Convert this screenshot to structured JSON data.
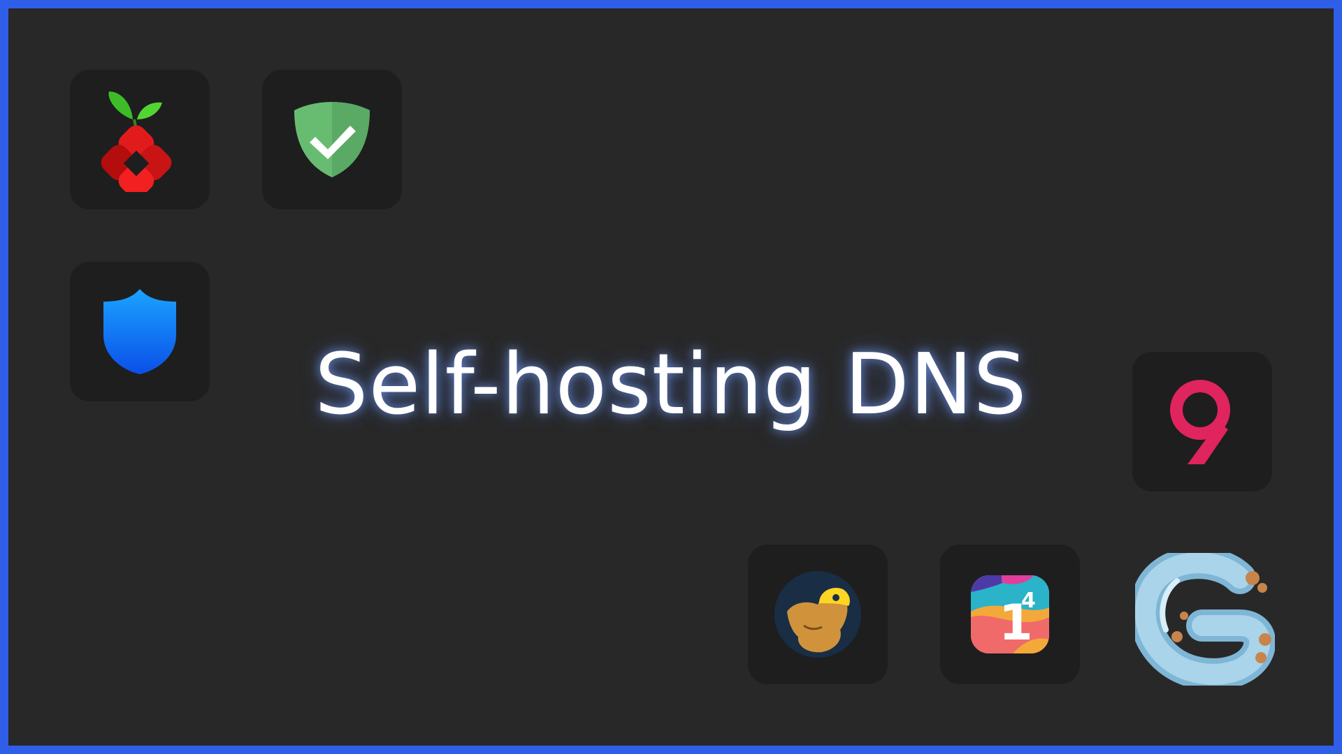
{
  "headline": "Self-hosting DNS",
  "colors": {
    "border": "#2f5fe8",
    "background": "#282828",
    "tile": "#1e1e1f",
    "glow": "#78a0ff"
  },
  "icons": [
    {
      "name": "pihole-icon"
    },
    {
      "name": "adguard-icon"
    },
    {
      "name": "technitium-shield-icon"
    },
    {
      "name": "quad9-icon",
      "glyph": "9"
    },
    {
      "name": "mullvad-mole-icon"
    },
    {
      "name": "one-one-one-one-icon",
      "glyph_main": "1",
      "glyph_sup": "4"
    },
    {
      "name": "coredns-snake-icon"
    }
  ]
}
